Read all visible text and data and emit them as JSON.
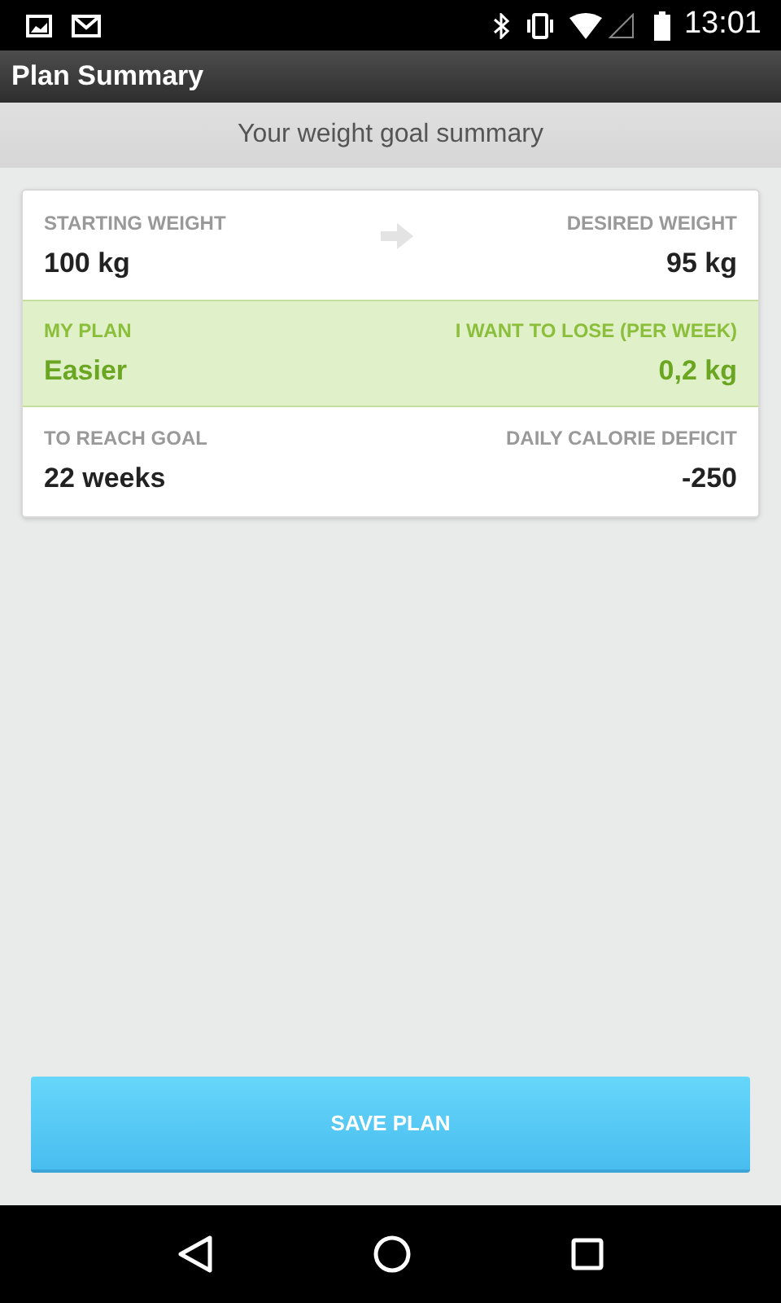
{
  "status_bar": {
    "time": "13:01"
  },
  "title_bar": {
    "title": "Plan Summary"
  },
  "subtitle": "Your weight goal summary",
  "summary_rows": [
    {
      "left_label": "STARTING WEIGHT",
      "left_value": "100 kg",
      "right_label": "DESIRED WEIGHT",
      "right_value": "95 kg",
      "highlighted": false,
      "arrow": true
    },
    {
      "left_label": "MY PLAN",
      "left_value": "Easier",
      "right_label": "I WANT TO LOSE (PER WEEK)",
      "right_value": "0,2 kg",
      "highlighted": true,
      "arrow": false
    },
    {
      "left_label": "TO REACH GOAL",
      "left_value": "22 weeks",
      "right_label": "DAILY CALORIE DEFICIT",
      "right_value": "-250",
      "highlighted": false,
      "arrow": false
    }
  ],
  "save_button": {
    "label": "SAVE PLAN"
  }
}
